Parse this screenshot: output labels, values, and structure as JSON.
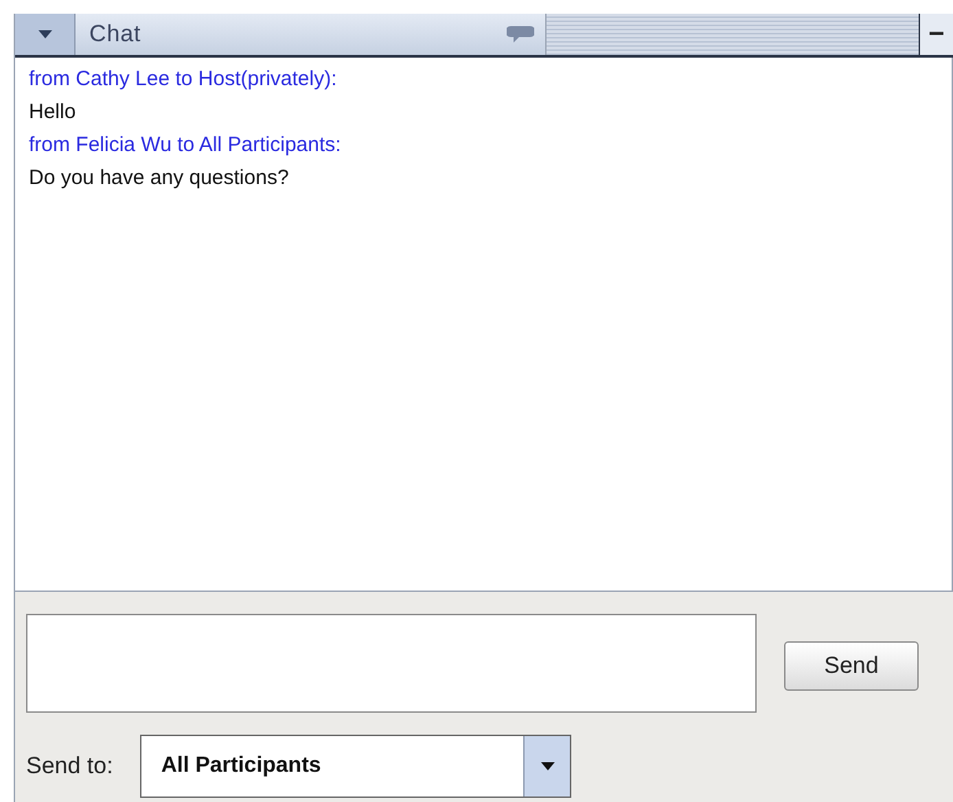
{
  "panel": {
    "title": "Chat",
    "collapse": "−"
  },
  "messages": [
    {
      "kind": "header",
      "text": "from Cathy Lee to Host(privately):"
    },
    {
      "kind": "body",
      "text": "Hello"
    },
    {
      "kind": "header",
      "text": "from Felicia Wu to All Participants:"
    },
    {
      "kind": "body",
      "text": "Do you have any questions?"
    }
  ],
  "send_button": "Send",
  "send_to": {
    "label": "Send to:",
    "value": "All Participants"
  }
}
